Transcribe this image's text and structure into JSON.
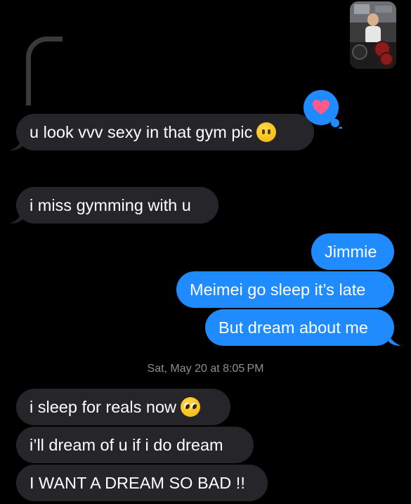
{
  "conversation": {
    "attachment": {
      "kind": "photo",
      "description_icon": "gym-photo-thumbnail"
    },
    "messages": [
      {
        "id": "m1",
        "direction": "incoming",
        "text": "u look vvv sexy in that gym pic",
        "emoji": "melting-face-emoji",
        "reaction": "heart-tapback-icon",
        "is_reply": true
      },
      {
        "id": "m2",
        "direction": "incoming",
        "text": "i miss gymming with u"
      },
      {
        "id": "m3",
        "direction": "outgoing",
        "text": "Jimmie"
      },
      {
        "id": "m4",
        "direction": "outgoing",
        "text": "Meimei go sleep it’s late"
      },
      {
        "id": "m5",
        "direction": "outgoing",
        "text": "But dream about me"
      },
      {
        "id": "m6",
        "direction": "incoming",
        "text": "i sleep for reals now",
        "emoji": "pleading-face-emoji"
      },
      {
        "id": "m7",
        "direction": "incoming",
        "text": "i’ll dream of u if i do dream"
      },
      {
        "id": "m8",
        "direction": "incoming",
        "text": "I WANT A DREAM SO BAD !!"
      }
    ],
    "timestamp": {
      "day": "Sat, May 20",
      "at": "at",
      "time": "8:05 PM",
      "full": "Sat, May 20 at 8:05 PM"
    }
  },
  "colors": {
    "background": "#000000",
    "incoming_bubble": "#26262a",
    "outgoing_bubble": "#1f8bff",
    "reaction_bubble": "#1f8bff",
    "heart": "#ff5a8c",
    "timestamp_text": "#8e8e93",
    "reply_thread_line": "#3a3a3c"
  }
}
